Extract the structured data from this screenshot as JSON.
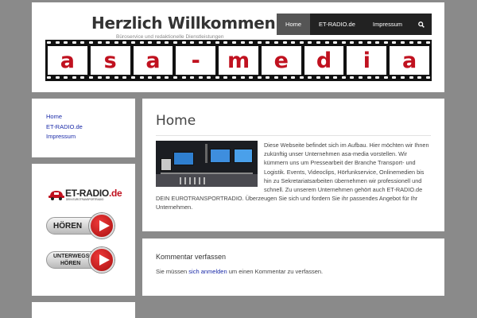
{
  "header": {
    "title": "Herzlich Willkommen",
    "description": "Büroservice und redaktionelle Dienstleistungen",
    "nav": [
      {
        "label": "Home",
        "active": true
      },
      {
        "label": "ET-RADIO.de",
        "active": false
      },
      {
        "label": "Impressum",
        "active": false
      }
    ],
    "search_icon": "search-icon",
    "banner_letters": [
      "a",
      "s",
      "a",
      "-",
      "m",
      "e",
      "d",
      "i",
      "a"
    ]
  },
  "sidebar": {
    "menu": [
      "Home",
      "ET-RADIO.de",
      "Impressum"
    ],
    "widget": {
      "logo_text": "ET-RADIO",
      "logo_suffix": ".de",
      "logo_subtitle": "DEIN EUROTRANSPORTRADIO",
      "listen_button": "HÖREN",
      "mobile_button_line1": "UNTERWEGS",
      "mobile_button_line2": "HÖREN"
    }
  },
  "main": {
    "title": "Home",
    "body": "Diese Webseite befindet sich im Aufbau. Hier möchten wir Ihnen zukünftig unser Unternehmen asa-media vorstellen. Wir kümmern uns um Pressearbeit der Branche Transport- und Logistik. Events, Videoclips, Hörfunkservice, Onlinemedien  bis hin zu Sekretariatsarbeiten übernehmen wir professionell und schnell. Zu unserem Unternehmen gehört auch ET-RADIO.de DEIN EUROTRANSPORTRADIO. Überzeugen Sie sich und fordern Sie ihr passendes Angebot für Ihr Unternehmen."
  },
  "comments": {
    "title": "Kommentar verfassen",
    "text_before": "Sie müssen ",
    "link": "sich anmelden",
    "text_after": " um einen Kommentar zu verfassen."
  },
  "colors": {
    "background": "#8a8a8a",
    "nav_background": "#222222",
    "nav_active": "#555555",
    "brand_red": "#c0111f",
    "link": "#1a2aa8"
  }
}
